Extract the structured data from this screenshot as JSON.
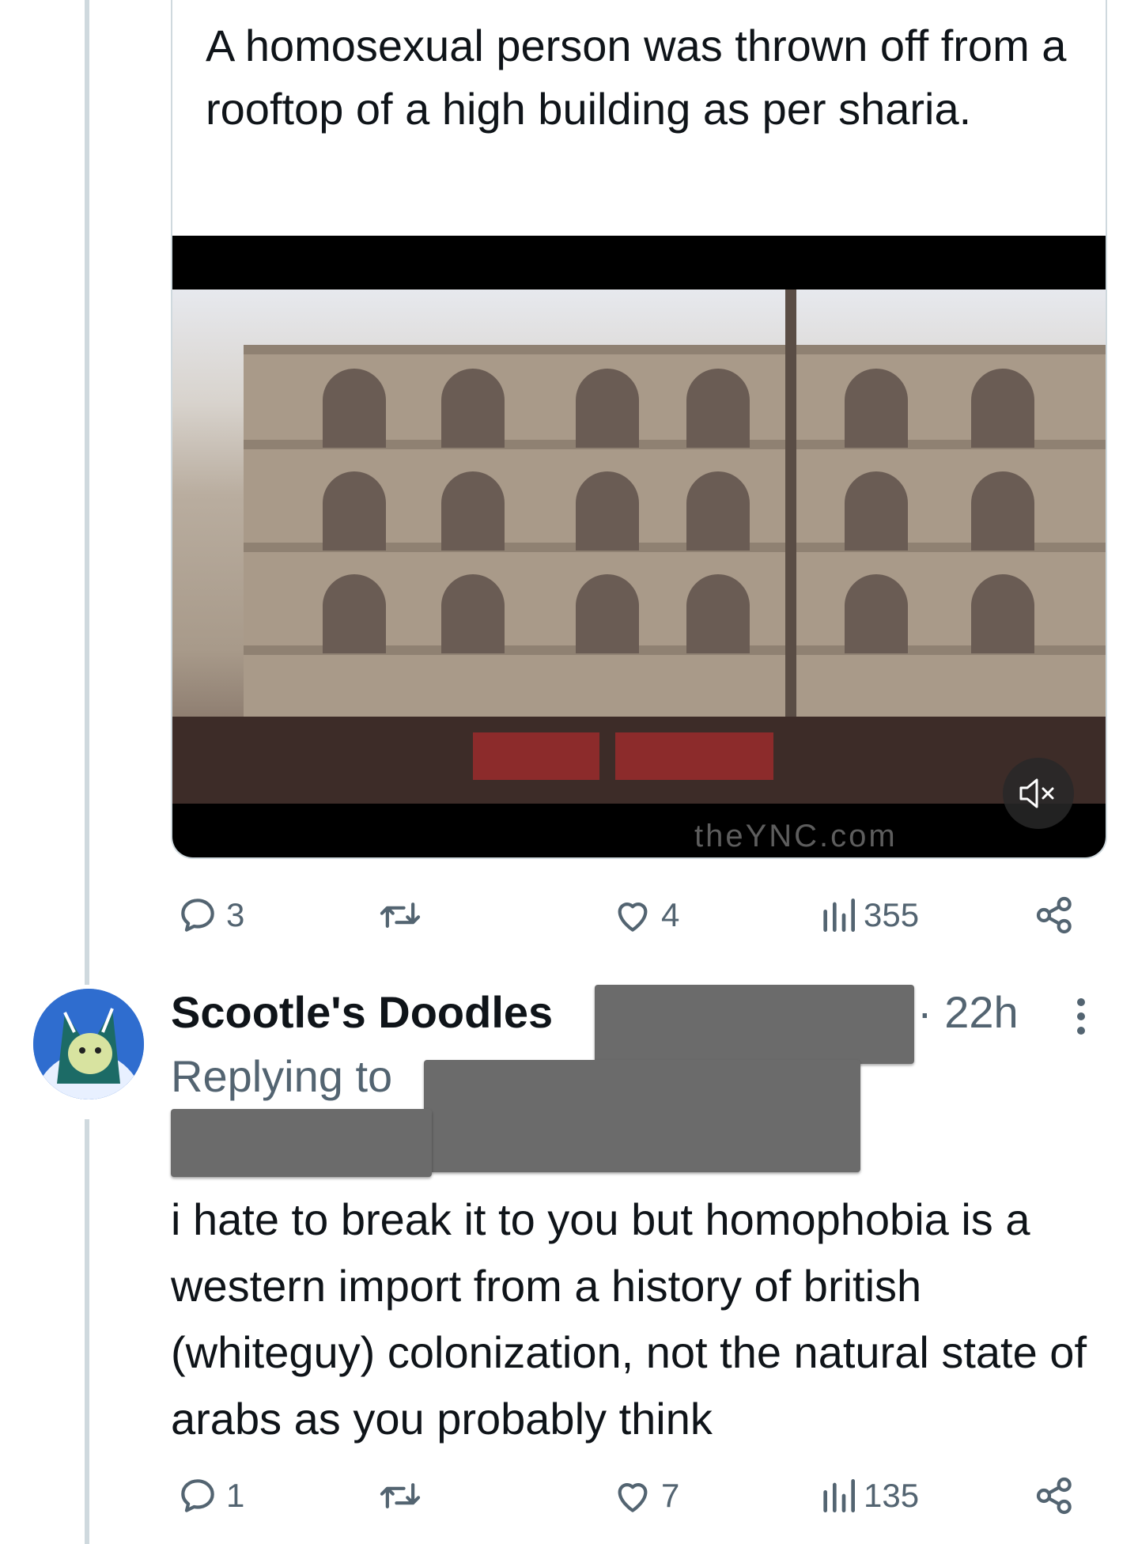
{
  "quoted_tweet": {
    "text": "A homosexual person was thrown off from a rooftop of a high building as per sharia.",
    "video": {
      "watermark": "theYNC.com",
      "muted": true
    }
  },
  "quoted_actions": {
    "replies": "3",
    "likes": "4",
    "views": "355"
  },
  "reply": {
    "author_name": "Scootle's Doodles",
    "time": "· 22h",
    "replying_to_label": "Replying to",
    "text": "i hate to break it to you but homophobia is a western import from a history of british (whiteguy) colonization, not the natural state of arabs as you probably think",
    "actions": {
      "replies": "1",
      "likes": "7",
      "views": "135"
    }
  },
  "icons": {
    "reply": "comment-bubble-icon",
    "retweet": "retweet-icon",
    "like": "heart-icon",
    "views": "analytics-bars-icon",
    "share": "share-icon",
    "mute": "volume-muted-icon",
    "more": "vertical-dots-icon"
  },
  "colors": {
    "secondary_text": "#536471",
    "thread_line": "#cfd9de",
    "redaction": "#6b6b6b"
  }
}
